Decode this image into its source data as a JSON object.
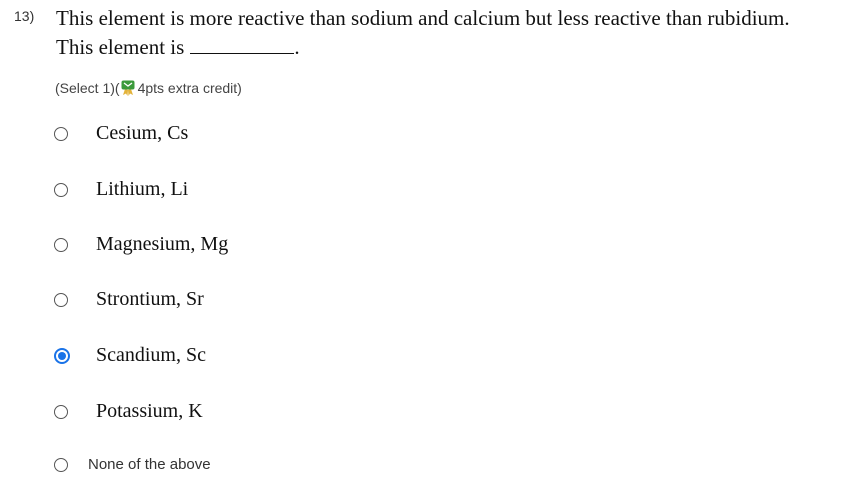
{
  "question": {
    "number": "13)",
    "text": "This element is more reactive than sodium and calcium but less reactive than rubidium. This element is",
    "trailing_punct": ".",
    "instruction_prefix": "(Select 1)(",
    "instruction_suffix": "4pts extra credit)",
    "badge_icon": "award-ribbon-icon"
  },
  "options": [
    {
      "label": "Cesium, Cs",
      "selected": false
    },
    {
      "label": "Lithium, Li",
      "selected": false
    },
    {
      "label": "Magnesium, Mg",
      "selected": false
    },
    {
      "label": "Strontium, Sr",
      "selected": false
    },
    {
      "label": "Scandium, Sc",
      "selected": true
    },
    {
      "label": "Potassium, K",
      "selected": false
    },
    {
      "label": "None of the above",
      "selected": false
    }
  ],
  "colors": {
    "accent": "#1a73e8",
    "badge_green": "#3a9a3a",
    "badge_gold": "#e3b33a"
  }
}
